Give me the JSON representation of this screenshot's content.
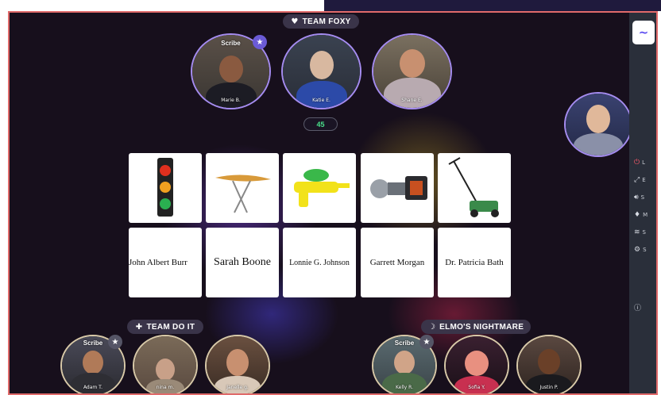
{
  "teams": {
    "foxy": {
      "label": "TEAM FOXY",
      "icon": "heart-icon",
      "members": [
        {
          "name": "Marie B.",
          "scribe": "Scribe"
        },
        {
          "name": "Katie E."
        },
        {
          "name": "Shane E."
        }
      ]
    },
    "do_it": {
      "label": "TEAM DO IT",
      "icon": "puzzle-icon",
      "members": [
        {
          "name": "Adam T.",
          "scribe": "Scribe"
        },
        {
          "name": "nina m."
        },
        {
          "name": "Janelle g."
        }
      ]
    },
    "elmo": {
      "label": "ELMO'S NIGHTMARE",
      "icon": "moon-icon",
      "members": [
        {
          "name": "Kelly R.",
          "scribe": "Scribe"
        },
        {
          "name": "Sofia Y."
        },
        {
          "name": "Justin P."
        }
      ]
    }
  },
  "timer": "45",
  "invention_cards": [
    "traffic light",
    "ironing board",
    "water gun",
    "gas mask",
    "lawn mower"
  ],
  "name_cards": [
    "John Albert Burr",
    "Sarah Boone",
    "Lonnie G. Johnson",
    "Garrett Morgan",
    "Dr. Patricia Bath"
  ],
  "sidebar": {
    "items": [
      {
        "icon": "leave-icon",
        "label": "L"
      },
      {
        "icon": "expand-icon",
        "label": "E"
      },
      {
        "icon": "speaker-icon",
        "label": "S"
      },
      {
        "icon": "mic-icon",
        "label": "M"
      },
      {
        "icon": "wifi-icon",
        "label": "S"
      },
      {
        "icon": "gear-icon",
        "label": "S"
      },
      {
        "icon": "info-icon",
        "label": ""
      }
    ]
  },
  "colors": {
    "accent": "#a58cf0",
    "timer": "#49e08a",
    "border": "#e06a6a"
  }
}
